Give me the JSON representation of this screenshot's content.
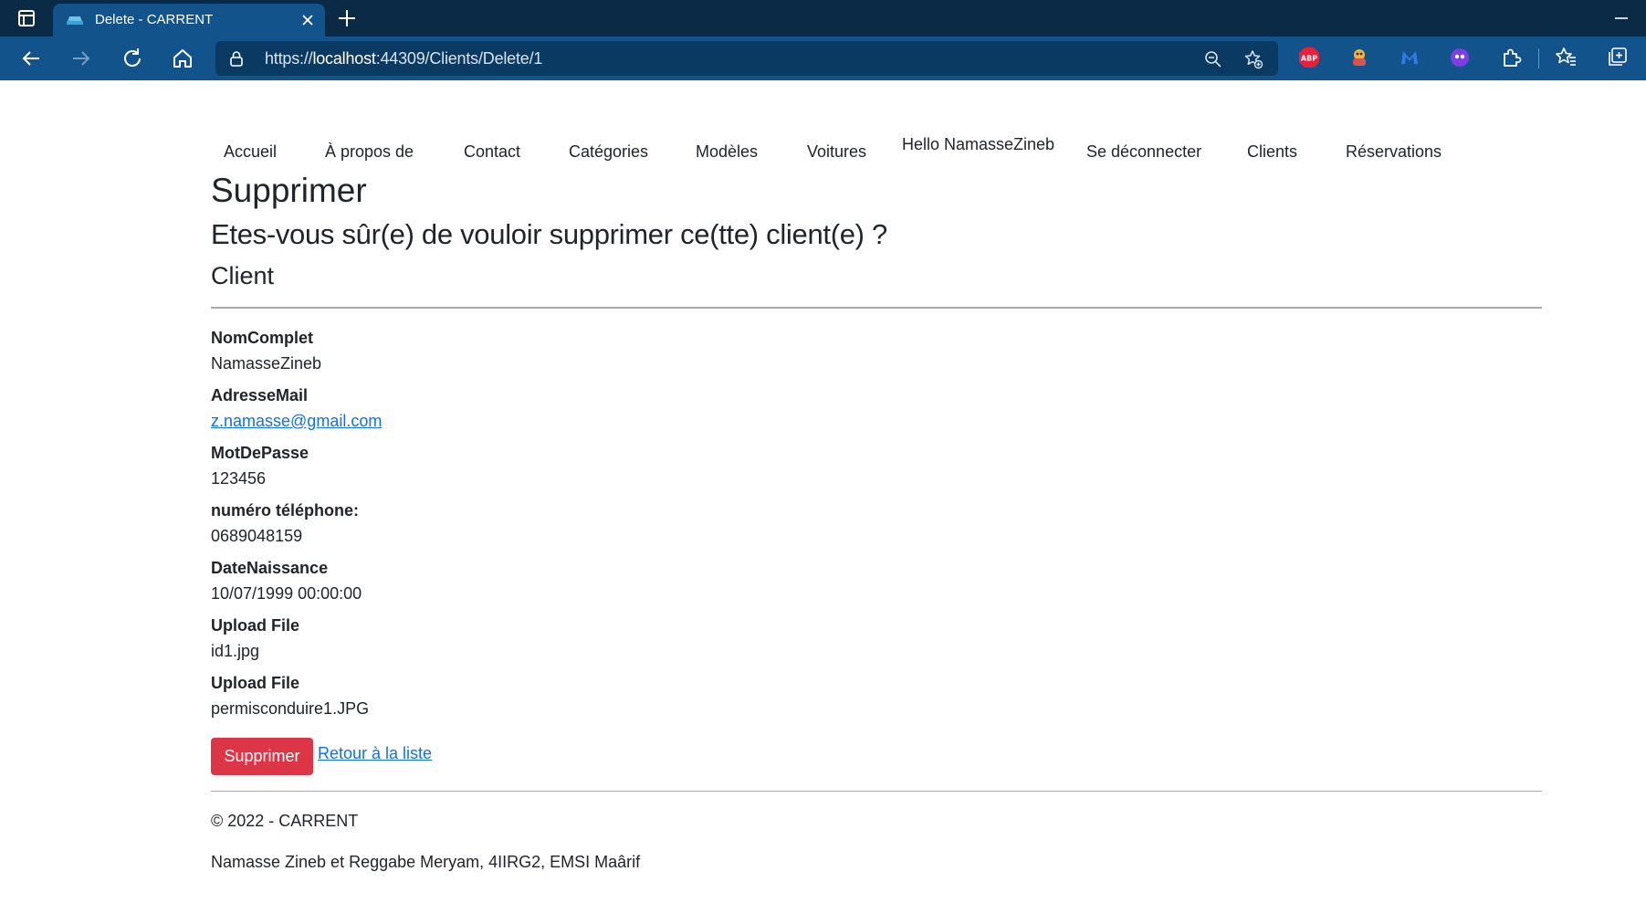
{
  "browser": {
    "tab_title": "Delete - CARRENT",
    "url_prefix": "https://",
    "url_host": "localhost",
    "url_rest": ":44309/Clients/Delete/1",
    "extensions": [
      "adblock-plus-icon",
      "extension-icon",
      "malwarebytes-icon",
      "extension-face-icon"
    ],
    "accent": "#12538b"
  },
  "nav": {
    "items": [
      "Accueil",
      "À propos de",
      "Contact",
      "Catégories",
      "Modèles",
      "Voitures",
      "Hello NamasseZineb",
      "Se déconnecter",
      "Clients",
      "Réservations"
    ]
  },
  "main": {
    "title": "Supprimer",
    "confirm": "Etes-vous sûr(e) de vouloir supprimer ce(tte) client(e) ?",
    "entity": "Client",
    "fields": [
      {
        "label": "NomComplet",
        "value": "NamasseZineb"
      },
      {
        "label": "AdresseMail",
        "value": "z.namasse@gmail.com"
      },
      {
        "label": "MotDePasse",
        "value": "123456"
      },
      {
        "label": "numéro téléphone:",
        "value": "0689048159"
      },
      {
        "label": "DateNaissance",
        "value": "10/07/1999 00:00:00"
      },
      {
        "label": "Upload File",
        "value": "id1.jpg"
      },
      {
        "label": "Upload File",
        "value": "permisconduire1.JPG"
      }
    ],
    "delete_button": "Supprimer",
    "back_link": "Retour à la liste",
    "danger_color": "#dc3545",
    "link_color": "#0d6efd"
  },
  "footer": {
    "copyright": "© 2022 - CARRENT",
    "authors": "Namasse Zineb et Reggabe Meryam, 4IIRG2, EMSI Maârif"
  }
}
